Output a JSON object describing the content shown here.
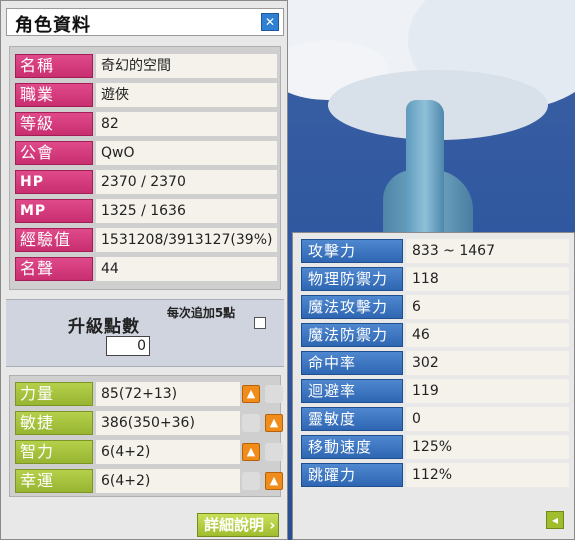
{
  "window": {
    "title": "角色資料",
    "close_icon": "close-icon",
    "colors": {
      "profile_label": "#d63b7d",
      "stat_label": "#a8c23e",
      "detail_label": "#3f78c2"
    }
  },
  "profile": [
    {
      "label": "名稱",
      "value": "奇幻的空間"
    },
    {
      "label": "職業",
      "value": "遊俠"
    },
    {
      "label": "等級",
      "value": "82"
    },
    {
      "label": "公會",
      "value": "QwO"
    },
    {
      "label": "HP",
      "value": "2370 / 2370"
    },
    {
      "label": "MP",
      "value": "1325 / 1636"
    },
    {
      "label": "經驗值",
      "value": "1531208/3913127(39%)"
    },
    {
      "label": "名聲",
      "value": "44"
    }
  ],
  "ability_points": {
    "label": "升級點數",
    "value": "0",
    "auto_label": "每次追加5點",
    "auto_checked": false
  },
  "stats": [
    {
      "label": "力量",
      "value": "85(72+13)"
    },
    {
      "label": "敏捷",
      "value": "386(350+36)"
    },
    {
      "label": "智力",
      "value": "6(4+2)"
    },
    {
      "label": "幸運",
      "value": "6(4+2)"
    }
  ],
  "detail_button_label": "詳細說明",
  "details": [
    {
      "label": "攻擊力",
      "value": "833 ~ 1467"
    },
    {
      "label": "物理防禦力",
      "value": "118"
    },
    {
      "label": "魔法攻擊力",
      "value": "6"
    },
    {
      "label": "魔法防禦力",
      "value": "46"
    },
    {
      "label": "命中率",
      "value": "302"
    },
    {
      "label": "迴避率",
      "value": "119"
    },
    {
      "label": "靈敏度",
      "value": "0"
    },
    {
      "label": "移動速度",
      "value": "125%"
    },
    {
      "label": "跳躍力",
      "value": "112%"
    }
  ]
}
